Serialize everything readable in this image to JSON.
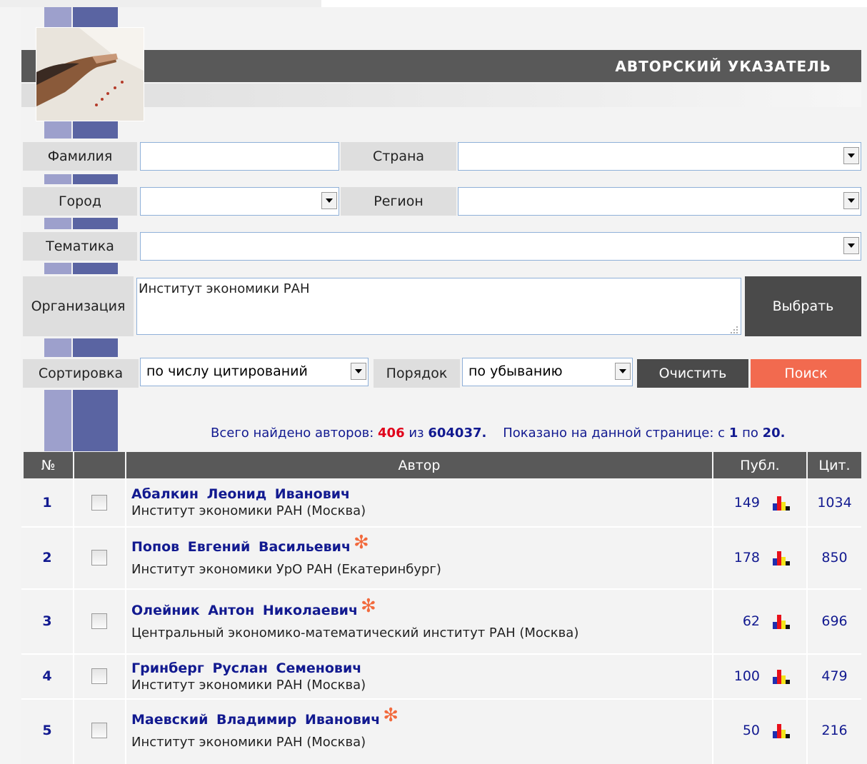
{
  "header": {
    "title": "АВТОРСКИЙ УКАЗАТЕЛЬ"
  },
  "form": {
    "surname_label": "Фамилия",
    "surname_value": "",
    "country_label": "Страна",
    "country_value": "",
    "city_label": "Город",
    "city_value": "",
    "region_label": "Регион",
    "region_value": "",
    "topic_label": "Тематика",
    "topic_value": "",
    "organization_label": "Организация",
    "organization_value": "Институт экономики РАН",
    "choose_button": "Выбрать",
    "sort_label": "Сортировка",
    "sort_value": "по числу цитирований",
    "order_label": "Порядок",
    "order_value": "по убыванию",
    "clear_button": "Очистить",
    "search_button": "Поиск"
  },
  "summary": {
    "prefix": "Всего найдено авторов:",
    "found": "406",
    "of": "из",
    "total": "604037",
    "shown_prefix": "Показано на данной странице: с",
    "from": "1",
    "to_word": "по",
    "to": "20"
  },
  "table": {
    "headers": {
      "num": "№",
      "author": "Автор",
      "pub": "Публ.",
      "cit": "Цит."
    },
    "rows": [
      {
        "num": "1",
        "name": "Абалкин Леонид Иванович",
        "org": "Институт экономики РАН (Москва)",
        "pub": "149",
        "cit": "1034",
        "star": false
      },
      {
        "num": "2",
        "name": "Попов Евгений Васильевич",
        "org": "Институт экономики УрО РАН (Екатеринбург)",
        "pub": "178",
        "cit": "850",
        "star": true
      },
      {
        "num": "3",
        "name": "Олейник Антон Николаевич",
        "org": "Центральный экономико-математический институт РАН (Москва)",
        "pub": "62",
        "cit": "696",
        "star": true
      },
      {
        "num": "4",
        "name": "Гринберг Руслан Семенович",
        "org": "Институт экономики РАН (Москва)",
        "pub": "100",
        "cit": "479",
        "star": false
      },
      {
        "num": "5",
        "name": "Маевский Владимир Иванович",
        "org": "Институт экономики РАН (Москва)",
        "pub": "50",
        "cit": "216",
        "star": true
      }
    ]
  },
  "icons": {
    "star": "✻",
    "chart": "bar-chart-icon",
    "dropdown": "chevron-down-icon"
  },
  "colors": {
    "accent_red": "#f26a3d",
    "link_blue": "#121a90",
    "header_gray": "#595959",
    "count_red": "#e0001a"
  }
}
